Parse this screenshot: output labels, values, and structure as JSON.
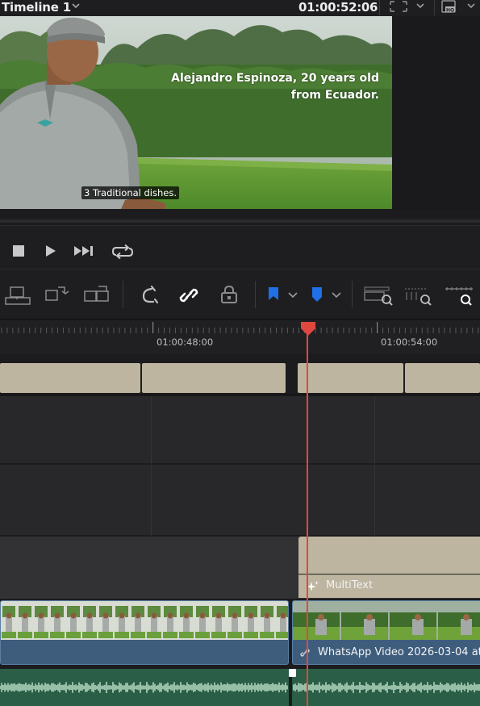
{
  "header": {
    "timeline_title": "Timeline 1",
    "timecode": "01:00:52:06"
  },
  "viewer": {
    "overlay_line1": "Alejandro Espinoza, 20 years old",
    "overlay_line2": "from Ecuador.",
    "subtitle": "3 Traditional dishes."
  },
  "ruler": {
    "label_1": "01:00:48:00",
    "label_2": "01:00:54:00"
  },
  "tracks": {
    "text_clip_label": "MultiText",
    "video_clip_label": "WhatsApp Video 2026-03-04 at"
  },
  "icons": {
    "stop": "stop-icon",
    "play": "play-icon",
    "next": "skip-forward-icon",
    "loop": "loop-icon",
    "snap": "snap-icon",
    "link": "link-icon",
    "lock": "lock-icon",
    "flag": "flag-icon",
    "marker": "marker-icon",
    "zoom": "zoom-icon"
  },
  "colors": {
    "playhead": "#e0483f",
    "flag_blue": "#1f6fe6",
    "text_clip": "#bdb5a0",
    "video_clip": "#3e5d7d",
    "audio_track": "#2b5e46"
  }
}
